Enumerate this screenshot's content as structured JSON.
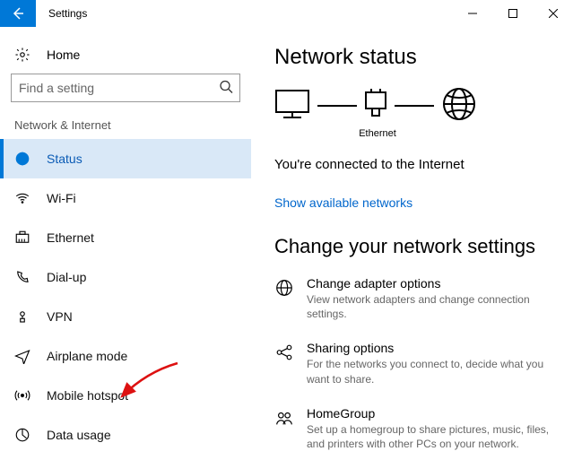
{
  "window": {
    "title": "Settings"
  },
  "sidebar": {
    "home": "Home",
    "search_placeholder": "Find a setting",
    "category": "Network & Internet",
    "items": [
      {
        "label": "Status"
      },
      {
        "label": "Wi-Fi"
      },
      {
        "label": "Ethernet"
      },
      {
        "label": "Dial-up"
      },
      {
        "label": "VPN"
      },
      {
        "label": "Airplane mode"
      },
      {
        "label": "Mobile hotspot"
      },
      {
        "label": "Data usage"
      }
    ]
  },
  "main": {
    "heading": "Network status",
    "diagram_label": "Ethernet",
    "status_text": "You're connected to the Internet",
    "show_networks": "Show available networks",
    "change_heading": "Change your network settings",
    "settings": [
      {
        "title": "Change adapter options",
        "desc": "View network adapters and change connection settings."
      },
      {
        "title": "Sharing options",
        "desc": "For the networks you connect to, decide what you want to share."
      },
      {
        "title": "HomeGroup",
        "desc": "Set up a homegroup to share pictures, music, files, and printers with other PCs on your network."
      }
    ]
  }
}
